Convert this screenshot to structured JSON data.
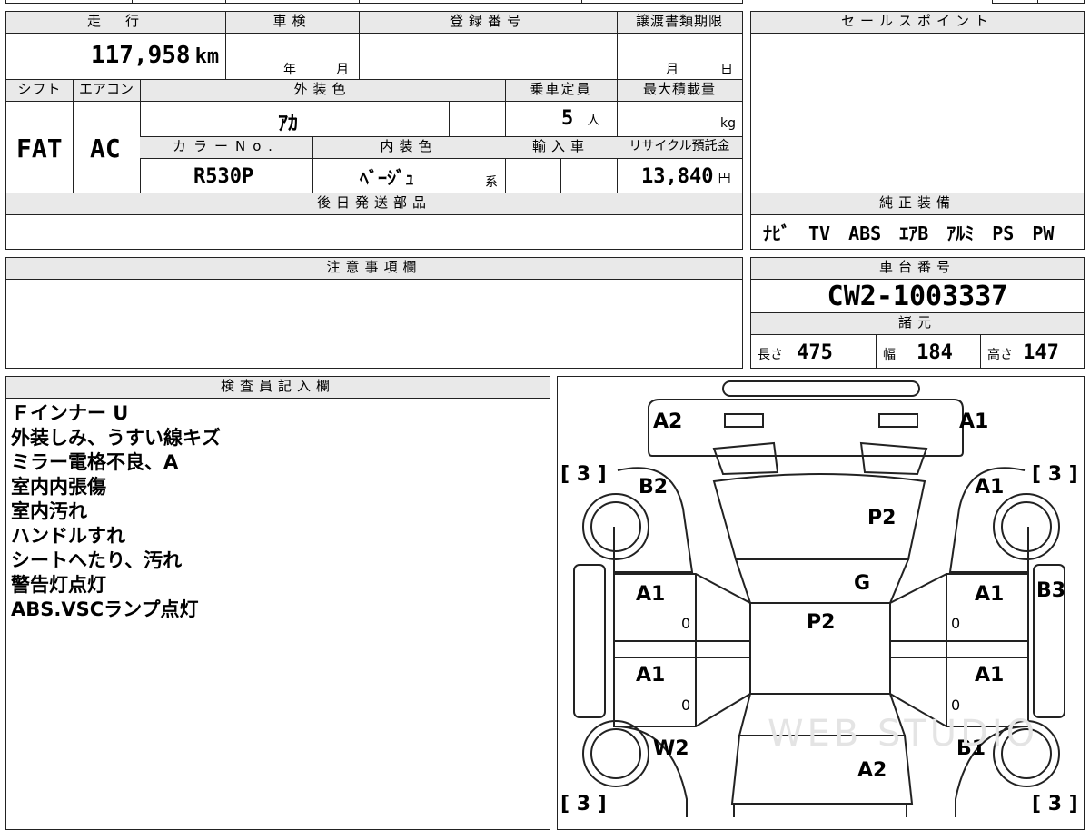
{
  "vehicle": {
    "headers": {
      "mileage": "走　行",
      "inspection": "車検",
      "registration": "登録番号",
      "transfer_deadline": "譲渡書類期限",
      "shift": "シフト",
      "aircon": "エアコン",
      "exterior_color": "外装色",
      "capacity": "乗車定員",
      "max_load": "最大積載量",
      "color_no": "カラーNo.",
      "interior_color": "内装色",
      "import": "輸入車",
      "recycle_fee": "リサイクル預託金",
      "later_parts": "後日発送部品"
    },
    "mileage_value": "117,958",
    "mileage_unit": "km",
    "inspection_year_label": "年",
    "inspection_month_label": "月",
    "transfer_month_label": "月",
    "transfer_day_label": "日",
    "shift_value": "FAT",
    "aircon_value": "AC",
    "exterior_color_value": "ｱｶ",
    "capacity_value": "5",
    "capacity_unit": "人",
    "max_load_unit": "kg",
    "color_no_value": "R530P",
    "interior_color_value": "ﾍﾞｰｼﾞｭ",
    "interior_color_suffix": "系",
    "recycle_fee_value": "13,840",
    "recycle_fee_unit": "円"
  },
  "sales_points": {
    "header": "セールスポイント"
  },
  "genuine_equipment": {
    "header": "純正装備",
    "items": "ﾅﾋﾞ　TV　ABS　ｴｱB　ｱﾙﾐ　PS　PW"
  },
  "notes": {
    "header": "注意事項欄"
  },
  "chassis": {
    "header": "車台番号",
    "value": "CW2-1003337"
  },
  "specs": {
    "header": "諸元",
    "length_label": "長さ",
    "length_value": "475",
    "width_label": "幅",
    "width_value": "184",
    "height_label": "高さ",
    "height_value": "147"
  },
  "inspector": {
    "header": "検査員記入欄",
    "lines": [
      "Ｆインナー U",
      "外装しみ、うすい線キズ",
      "ミラー電格不良、A",
      "室内内張傷",
      "室内汚れ",
      "ハンドルすれ",
      "シートへたり、汚れ",
      "警告灯点灯",
      "ABS.VSCランプ点灯"
    ]
  },
  "diagram": {
    "marks": {
      "front_left": "A2",
      "front_right": "A1",
      "fender_left": "B2",
      "fender_right": "A1",
      "hood": "P2",
      "windshield": "G",
      "roof": "P2",
      "front_door_left": "A1",
      "front_door_right": "A1",
      "rear_door_left": "A1",
      "rear_door_right": "A1",
      "side_right": "B3",
      "rear_quarter_left": "W2",
      "rear_quarter_right": "B1",
      "trunk": "A2"
    },
    "tire_tread": "[ 3 ]",
    "door_zero": "0",
    "watermark": "WEB STUDIO"
  }
}
